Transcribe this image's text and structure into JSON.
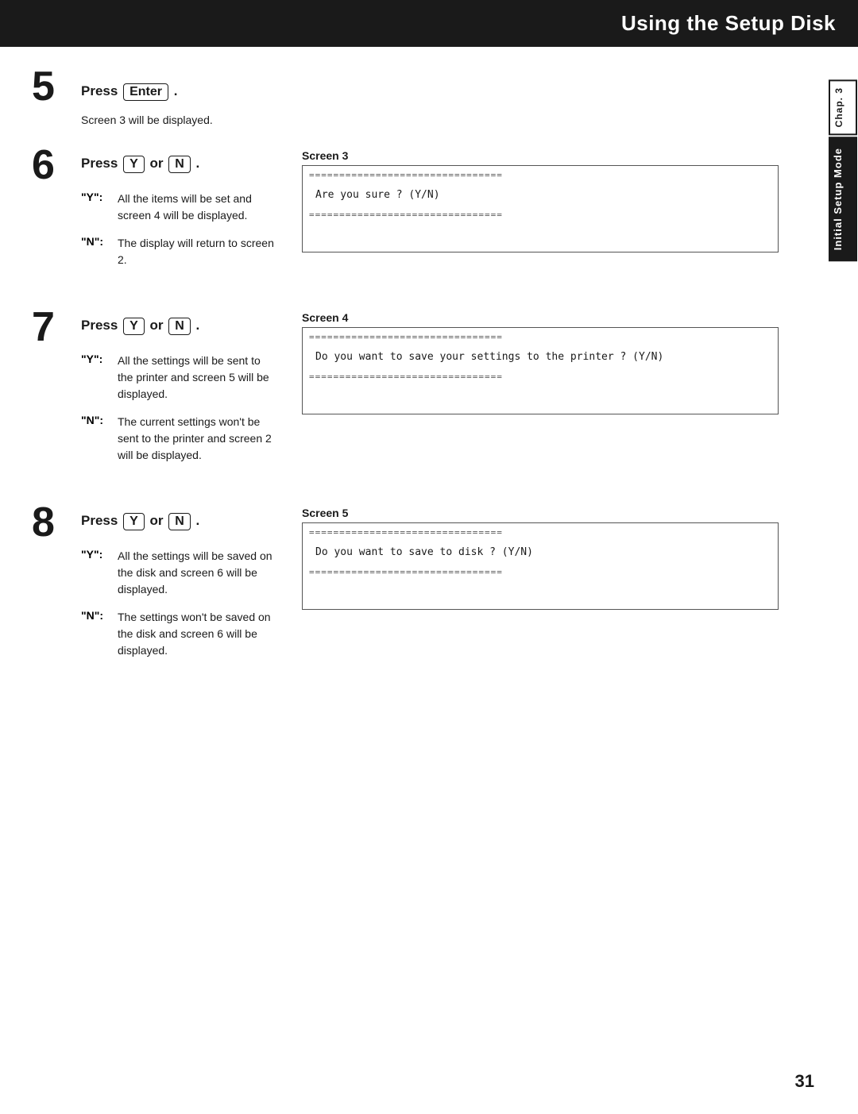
{
  "header": {
    "title": "Using the Setup Disk"
  },
  "side_tab": {
    "chap_label": "Chap. 3",
    "main_label": "Initial Setup Mode"
  },
  "page_number": "31",
  "steps": {
    "step5": {
      "number": "5",
      "instruction_prefix": "Press",
      "key": "Enter",
      "instruction_suffix": ".",
      "detail": "Screen 3 will be displayed."
    },
    "step6": {
      "number": "6",
      "instruction_prefix": "Press",
      "key_y": "Y",
      "or_text": "or",
      "key_n": "N",
      "instruction_suffix": ".",
      "option_y_label": "\"Y\":",
      "option_y_text": "All the items will be set and screen 4 will be displayed.",
      "option_n_label": "\"N\":",
      "option_n_text": "The display will return to screen 2.",
      "screen_label": "Screen 3",
      "screen_dashes": "================================",
      "screen_text": "Are you sure ? (Y/N)",
      "screen_dashes_bottom": "================================"
    },
    "step7": {
      "number": "7",
      "instruction_prefix": "Press",
      "key_y": "Y",
      "or_text": "or",
      "key_n": "N",
      "instruction_suffix": ".",
      "option_y_label": "\"Y\":",
      "option_y_text": "All the settings will be sent to the printer and screen 5 will be displayed.",
      "option_n_label": "\"N\":",
      "option_n_text": "The current settings won't be sent to the printer and screen 2 will be displayed.",
      "screen_label": "Screen 4",
      "screen_dashes": "================================",
      "screen_text": "Do you want to save your settings to the printer ? (Y/N)",
      "screen_dashes_bottom": "================================"
    },
    "step8": {
      "number": "8",
      "instruction_prefix": "Press",
      "key_y": "Y",
      "or_text": "or",
      "key_n": "N",
      "instruction_suffix": ".",
      "option_y_label": "\"Y\":",
      "option_y_text": "All the settings will be saved on the disk and screen 6 will be displayed.",
      "option_n_label": "\"N\":",
      "option_n_text": "The settings won't be saved on the disk and screen 6 will be displayed.",
      "screen_label": "Screen 5",
      "screen_dashes": "================================",
      "screen_text": "Do you want to save to disk ? (Y/N)",
      "screen_dashes_bottom": "================================"
    }
  }
}
